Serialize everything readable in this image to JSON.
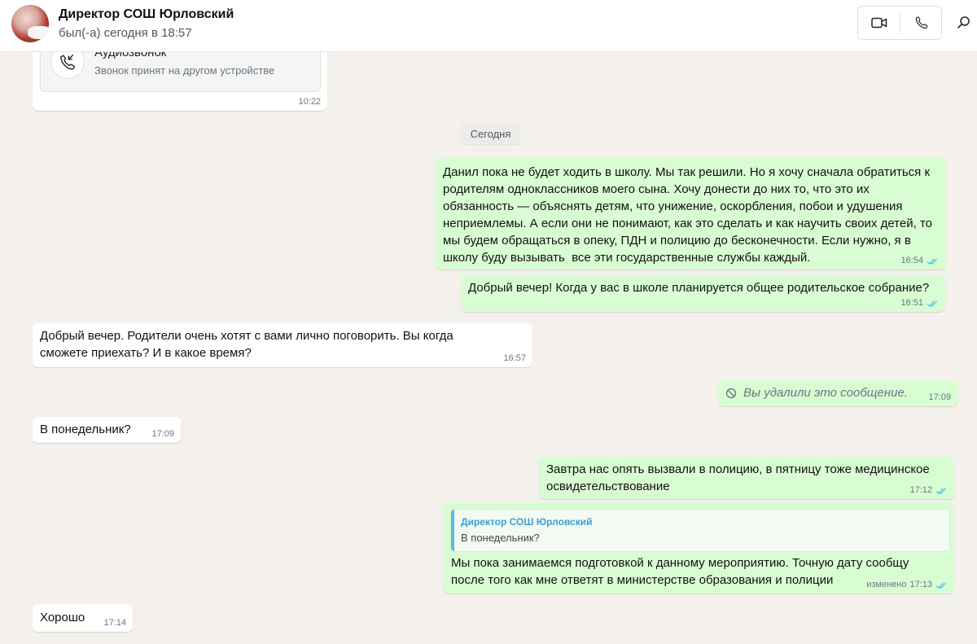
{
  "header": {
    "contact_name": "Директор СОШ Юрловский",
    "status": "был(-а) сегодня в 18:57",
    "icons": {
      "video": "video-camera-icon",
      "call": "phone-icon",
      "search": "search-icon"
    }
  },
  "colors": {
    "outgoing_bubble": "#d9fdd3",
    "incoming_bubble": "#ffffff",
    "read_ticks": "#53bdeb",
    "quote_accent": "#53bdeb",
    "chat_background": "#f4f1ec"
  },
  "call_message": {
    "title": "Аудиозвонок",
    "subtitle": "Звонок принят на другом устройстве",
    "time": "10:22",
    "icon": "incoming-call-icon"
  },
  "date_divider": "Сегодня",
  "messages": [
    {
      "direction": "out",
      "text": "Данил пока не будет ходить в школу. Мы так решили. Но я хочу сначала обратиться к родителям одноклассников моего сына. Хочу донести до них то, что это их обязанность — объяснять детям, что унижение, оскорбления, побои и удушения неприемлемы. А если они не понимают, как это сделать и как научить своих детей, то мы будем обращаться в опеку, ПДН и полицию до бесконечности. Если нужно, я в школу буду вызывать  все эти государственные службы каждый.",
      "time": "16:54",
      "status": "read"
    },
    {
      "direction": "out",
      "text": "Добрый вечер! Когда у вас в школе планируется общее родительское собрание?",
      "time": "16:51",
      "status": "read"
    },
    {
      "direction": "in",
      "text": "Добрый вечер. Родители очень хотят с вами лично поговорить. Вы когда сможете приехать? И в какое время?",
      "time": "16:57"
    },
    {
      "direction": "out",
      "text": "Вы удалили это сообщение.",
      "time": "17:09",
      "deleted": true,
      "icon": "deleted-circle-icon"
    },
    {
      "direction": "in",
      "text": "В понедельник?",
      "time": "17:09"
    },
    {
      "direction": "out",
      "text": "Завтра нас опять вызвали в полицию, в пятницу тоже медицинское освидетельствование",
      "time": "17:12",
      "status": "read"
    },
    {
      "direction": "out",
      "quote_author": "Директор СОШ Юрловский",
      "quote_text": "В понедельник?",
      "text": "Мы пока занимаемся подготовкой к данному мероприятию. Точную дату сообщу после того как мне ответят в министерстве образования и полиции",
      "edited_label": "изменено",
      "time": "17:13",
      "status": "read"
    },
    {
      "direction": "in",
      "text": "Хорошо",
      "time": "17:14"
    }
  ]
}
